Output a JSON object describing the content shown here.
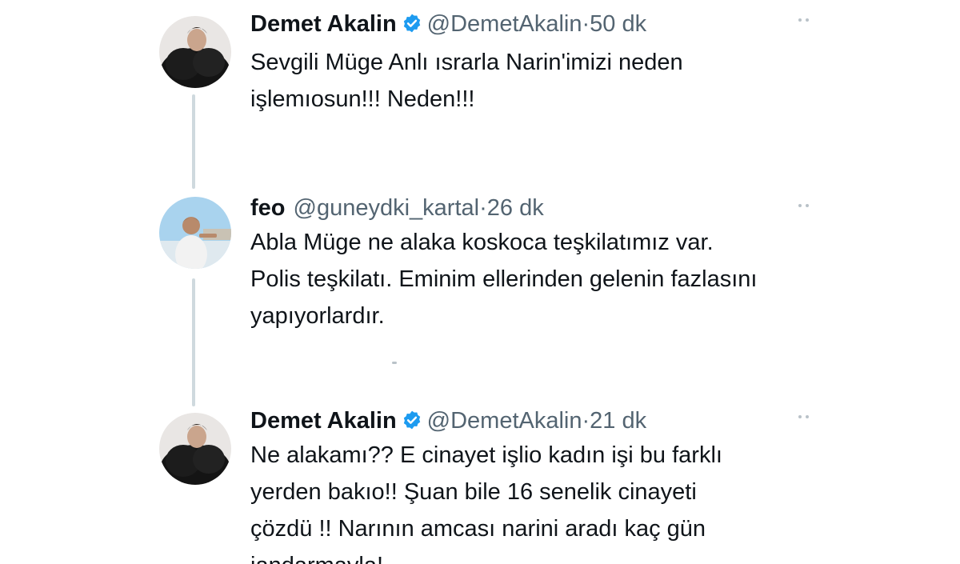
{
  "colors": {
    "text": "#0f1419",
    "muted": "#536471",
    "verified_blue": "#1d9bf0",
    "thread_line": "#cfd9de"
  },
  "tweets": [
    {
      "name": "Demet Akalin",
      "verified": true,
      "handle": "@DemetAkalin",
      "separator": "·",
      "time": "50 dk",
      "more_icon": "more-dots-icon",
      "lines": [
        "Sevgili Müge Anlı ısrarla Narin'imizi neden",
        "işlemıosun!!! Neden!!!"
      ]
    },
    {
      "name": "feo",
      "verified": false,
      "handle": "@guneydki_kartal",
      "separator": "·",
      "time": "26 dk",
      "more_icon": "more-dots-icon",
      "lines": [
        "Abla Müge ne alaka koskoca teşkilatımız var.",
        "Polis teşkilatı. Eminim ellerinden gelenin fazlasını",
        "yapıyorlardır."
      ]
    },
    {
      "name": "Demet Akalin",
      "verified": true,
      "handle": "@DemetAkalin",
      "separator": "·",
      "time": "21 dk",
      "more_icon": "more-dots-icon",
      "lines": [
        "Ne alakamı?? E cinayet işlio kadın işi bu farklı",
        "yerden bakıo!! Şuan bile 16 senelik cinayeti",
        "çözdü !! Narının amcası narini aradı kaç gün",
        "jandarmayla!"
      ]
    }
  ]
}
